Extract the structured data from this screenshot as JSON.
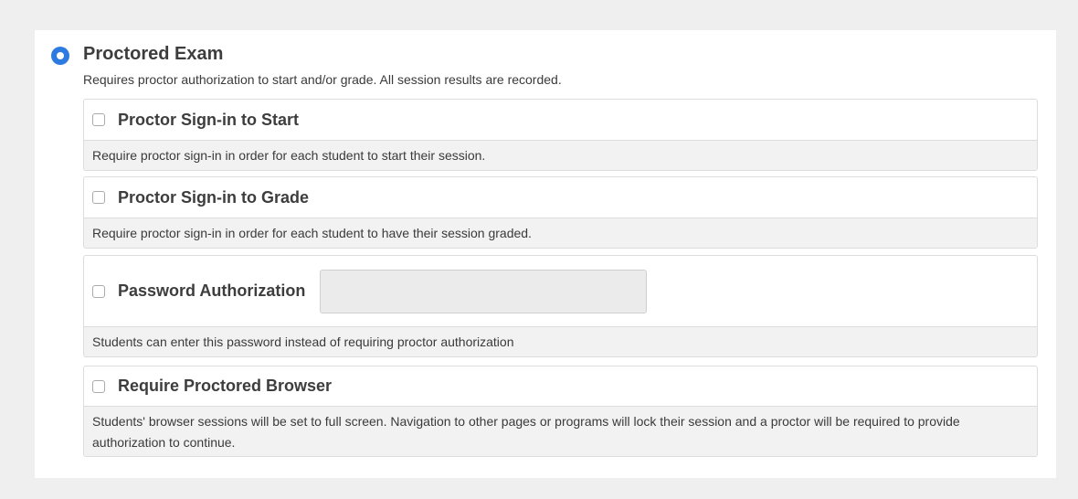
{
  "exam_option": {
    "title": "Proctored Exam",
    "description": "Requires proctor authorization to start and/or grade. All session results are recorded.",
    "selected": true
  },
  "options": [
    {
      "label": "Proctor Sign-in to Start",
      "checked": false,
      "description": "Require proctor sign-in in order for each student to start their session."
    },
    {
      "label": "Proctor Sign-in to Grade",
      "checked": false,
      "description": "Require proctor sign-in in order for each student to have their session graded."
    },
    {
      "label": "Password Authorization",
      "checked": false,
      "input_value": "",
      "input_placeholder": "",
      "description": "Students can enter this password instead of requiring proctor authorization"
    },
    {
      "label": "Require Proctored Browser",
      "checked": false,
      "description": "Students' browser sessions will be set to full screen. Navigation to other pages or programs will lock their session and a proctor will be required to provide authorization to continue."
    }
  ],
  "colors": {
    "accent": "#2d7be0",
    "page_background": "#efefef",
    "panel_footer": "#f2f2f2"
  }
}
